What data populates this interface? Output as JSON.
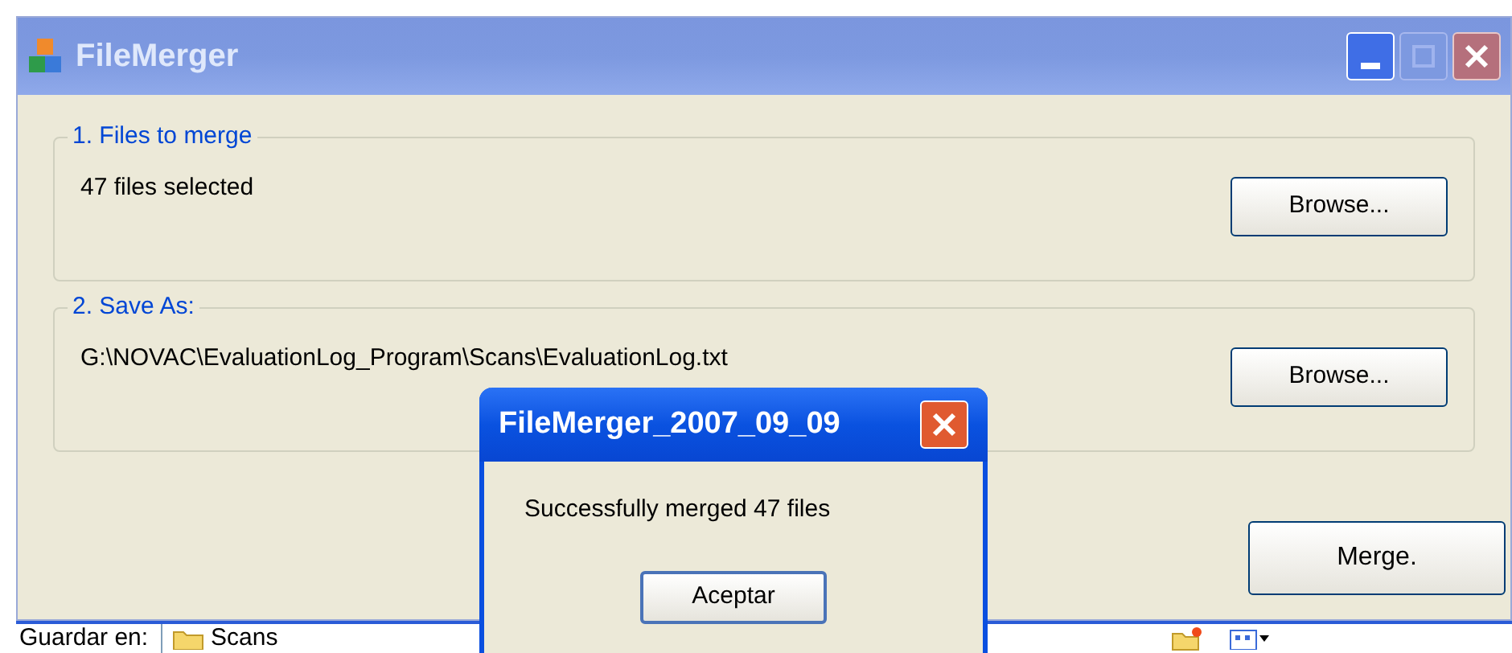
{
  "window": {
    "title": "FileMerger"
  },
  "groups": [
    {
      "label": "1. Files to merge",
      "value": "47 files selected",
      "button": "Browse..."
    },
    {
      "label": "2. Save As:",
      "value": "G:\\NOVAC\\EvaluationLog_Program\\Scans\\EvaluationLog.txt",
      "button": "Browse..."
    }
  ],
  "merge_button": "Merge.",
  "dialog": {
    "title": "FileMerger_2007_09_09",
    "message": "Successfully merged 47 files",
    "button": "Aceptar"
  },
  "background_window": {
    "label": "Guardar en:",
    "folder": "Scans"
  }
}
